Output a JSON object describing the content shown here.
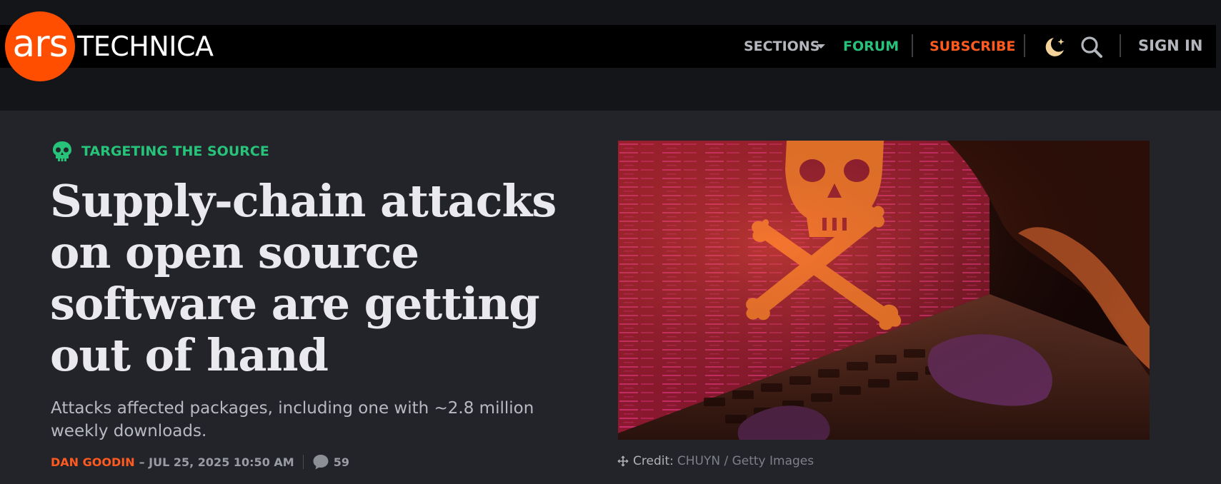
{
  "brand": {
    "logo_mark": "ars",
    "logo_word": "TECHNICA",
    "accent_color": "#ff4e00"
  },
  "nav": {
    "sections_label": "SECTIONS",
    "forum_label": "FORUM",
    "subscribe_label": "SUBSCRIBE",
    "theme_icon": "moon-sparkle-icon",
    "search_icon": "search-icon",
    "sign_in_label": "SIGN IN",
    "forum_color": "#27c37a",
    "subscribe_color": "#ff5a1f"
  },
  "article": {
    "kicker_icon": "skull-icon",
    "kicker": "TARGETING THE SOURCE",
    "headline": "Supply-chain attacks on open source software are getting out of hand",
    "dek": "Attacks affected packages, including one with ~2.8 million weekly downloads.",
    "author": "DAN GOODIN",
    "date": "– JUL 25, 2025 10:50 AM",
    "comment_icon": "comment-bubble-icon",
    "comment_count": "59"
  },
  "hero_image": {
    "subject": "skull-and-crossbones-on-laptop-screen",
    "credit_label": "Credit:",
    "credit_source": "CHUYN / Getty Images"
  }
}
